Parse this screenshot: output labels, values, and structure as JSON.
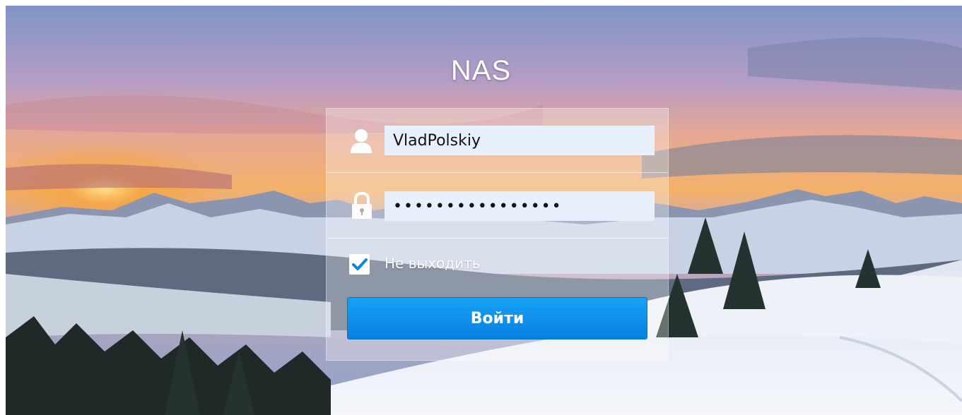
{
  "app": {
    "title": "NAS"
  },
  "login": {
    "username_value": "VladPolskiy",
    "password_value": "••••••••••••••••",
    "remember_label": "Не выходить",
    "remember_checked": true,
    "submit_label": "Войти"
  },
  "colors": {
    "accent": "#0a86e6",
    "autofill_bg": "#e8f0fe"
  },
  "icons": [
    "user-icon",
    "lock-icon",
    "checkmark-icon"
  ]
}
